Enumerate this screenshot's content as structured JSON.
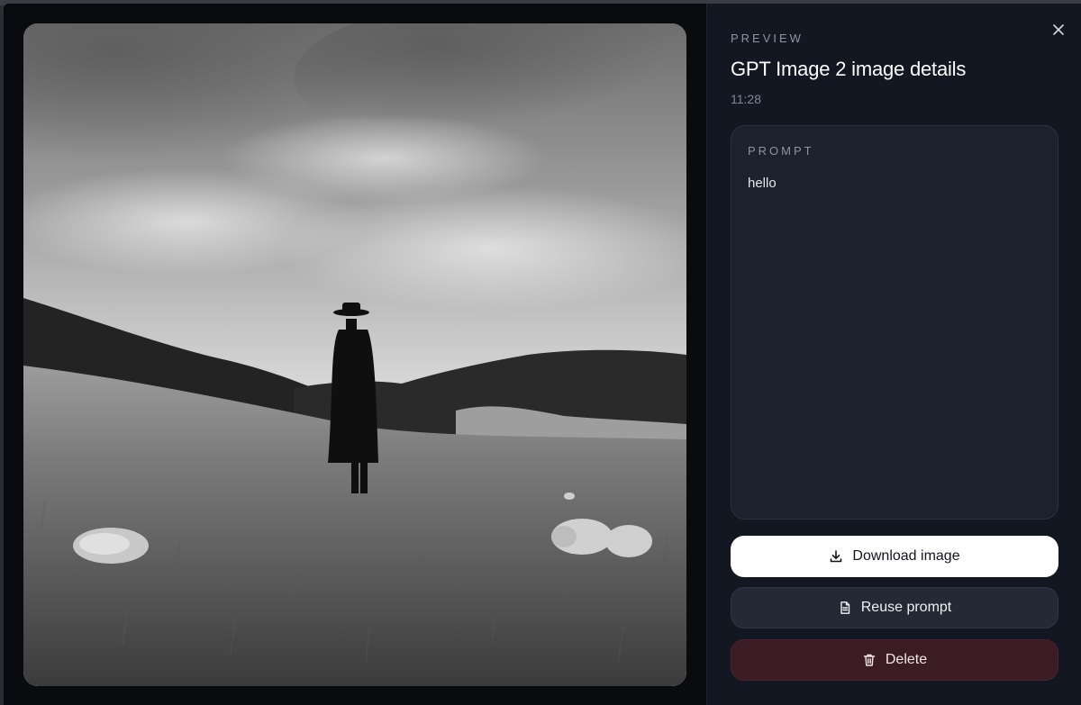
{
  "preview": {
    "eyebrow": "PREVIEW",
    "title": "GPT Image 2 image details",
    "timestamp": "11:28"
  },
  "prompt": {
    "label": "PROMPT",
    "text": "hello"
  },
  "actions": {
    "download_label": "Download image",
    "reuse_label": "Reuse prompt",
    "delete_label": "Delete"
  },
  "colors": {
    "panel_bg": "#121722",
    "card_bg": "#1b212d",
    "primary_button": "#ffffff",
    "delete_button": "#3b1c24"
  },
  "icons": {
    "close": "close-icon",
    "download": "download-icon",
    "reuse": "document-icon",
    "delete": "trash-icon"
  }
}
